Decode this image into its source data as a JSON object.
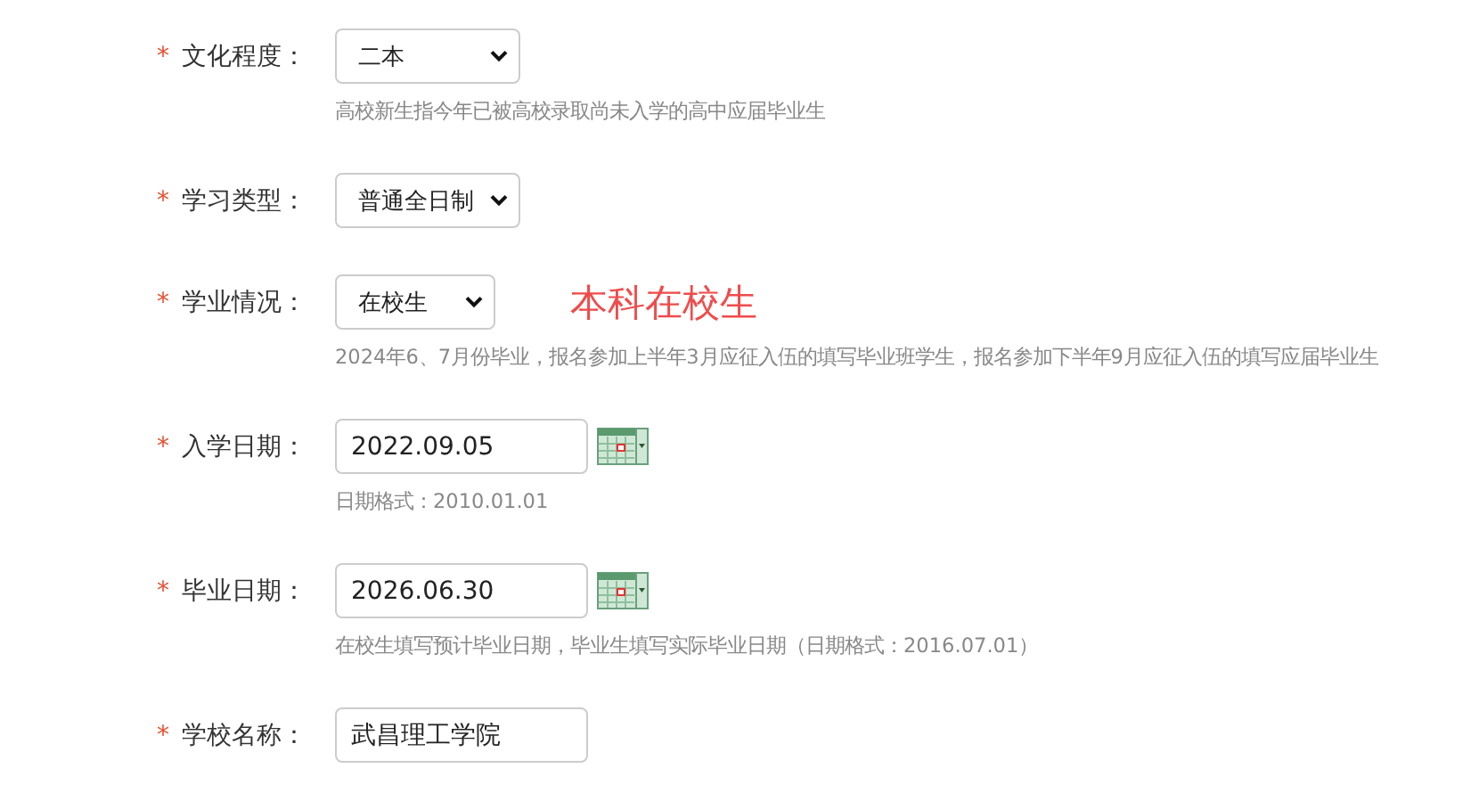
{
  "fields": [
    {
      "kind": "select",
      "required_mark": "*",
      "label": "文化程度：",
      "value": "二本",
      "hint": "高校新生指今年已被高校录取尚未入学的高中应届毕业生"
    },
    {
      "kind": "select",
      "required_mark": "*",
      "label": "学习类型：",
      "value": "普通全日制"
    },
    {
      "kind": "select",
      "required_mark": "*",
      "label": "学业情况：",
      "value": "在校生",
      "note": "本科在校生",
      "hint": "2024年6、7月份毕业，报名参加上半年3月应征入伍的填写毕业班学生，报名参加下半年9月应征入伍的填写应届毕业生"
    },
    {
      "kind": "date",
      "required_mark": "*",
      "label": "入学日期：",
      "value": "2022.09.05",
      "hint": "日期格式：2010.01.01"
    },
    {
      "kind": "date",
      "required_mark": "*",
      "label": "毕业日期：",
      "value": "2026.06.30",
      "hint": "在校生填写预计毕业日期，毕业生填写实际毕业日期（日期格式：2016.07.01）"
    },
    {
      "kind": "text",
      "required_mark": "*",
      "label": "学校名称：",
      "value": "武昌理工学院"
    }
  ]
}
